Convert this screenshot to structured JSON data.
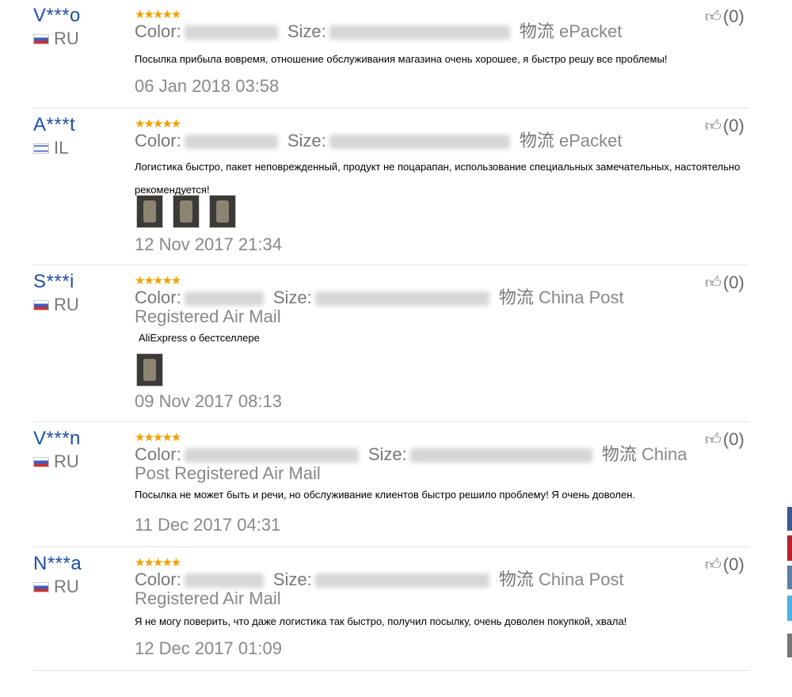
{
  "labels": {
    "color": "Color:",
    "size": "Size:",
    "shipping": "物流"
  },
  "reviews": [
    {
      "user": "V***o",
      "country": "RU",
      "flag": "ru",
      "stars": "★★★★★",
      "likes": "(0)",
      "shipping": "ePacket",
      "text": "Посылка прибыла вовремя, отношение обслуживания магазина очень хорошее, я быстро решу все проблемы!",
      "date": "06 Jan 2018 03:58"
    },
    {
      "user": "A***t",
      "country": "IL",
      "flag": "il",
      "stars": "★★★★★",
      "likes": "(0)",
      "shipping": "ePacket",
      "text": "Логистика быстро, пакет неповрежденный, продукт не поцарапан, использование специальных замечательных, настоятельно рекомендуется!",
      "date": "12 Nov 2017 21:34"
    },
    {
      "user": "S***i",
      "country": "RU",
      "flag": "ru",
      "stars": "★★★★★",
      "likes": "(0)",
      "shipping": "China Post Registered Air Mail",
      "text": "AliExpress о бестселлере",
      "date": "09 Nov 2017 08:13"
    },
    {
      "user": "V***n",
      "country": "RU",
      "flag": "ru",
      "stars": "★★★★★",
      "likes": "(0)",
      "shipping": "China Post Registered Air Mail",
      "text": "Посылка не может быть и речи, но обслуживание клиентов быстро решило проблему! Я очень доволен.",
      "date": "11 Dec 2017 04:31"
    },
    {
      "user": "N***a",
      "country": "RU",
      "flag": "ru",
      "stars": "★★★★★",
      "likes": "(0)",
      "shipping": "China Post Registered Air Mail",
      "text": "Я не могу поверить, что даже логистика так быстро, получил посылку, очень доволен покупкой, хвала!",
      "date": "12 Dec 2017 01:09"
    }
  ],
  "icons": {
    "like": "thumbs-up-icon"
  },
  "colors": {
    "username": "#1f4fa6",
    "stars": "#f2a100",
    "share_bar": [
      "#3b5998",
      "#b8232f",
      "#55acee",
      "#4ab3e6",
      "#777777"
    ]
  }
}
